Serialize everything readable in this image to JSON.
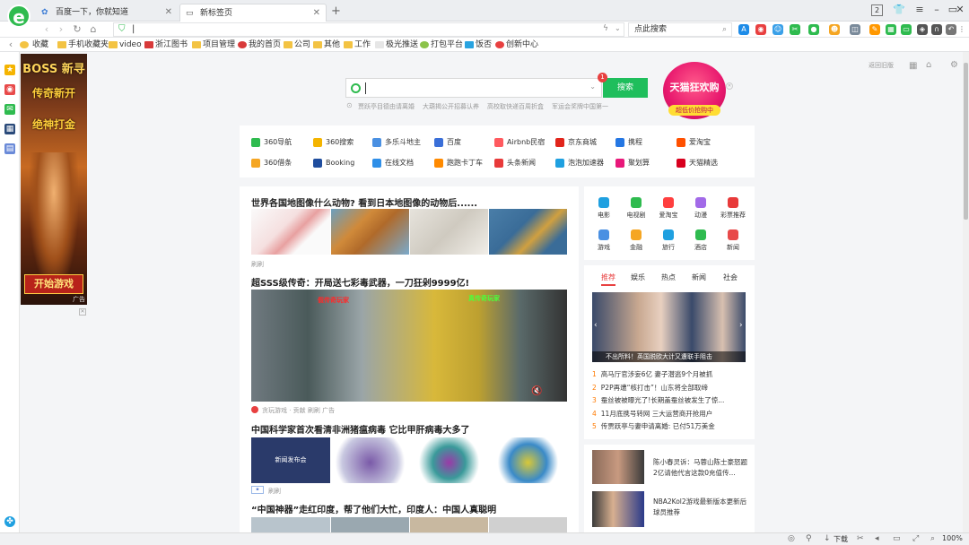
{
  "browser": {
    "logo_glyph": "e",
    "tabs": [
      {
        "title": "百度一下，你就知道",
        "icon": "baidu-icon"
      },
      {
        "title": "新标签页",
        "icon": "newtab-icon"
      }
    ],
    "new_tab_symbol": "+",
    "window_counter": "2",
    "address_value": "|",
    "search_placeholder": "点此搜索"
  },
  "bookmarks": [
    {
      "label": "收藏"
    },
    {
      "label": "手机收藏夹"
    },
    {
      "label": "video"
    },
    {
      "label": "浙江图书"
    },
    {
      "label": "项目管理"
    },
    {
      "label": "我的首页"
    },
    {
      "label": "公司"
    },
    {
      "label": "其他"
    },
    {
      "label": "工作"
    },
    {
      "label": "极光推送"
    },
    {
      "label": "打包平台"
    },
    {
      "label": "饭否"
    },
    {
      "label": "创新中心"
    }
  ],
  "ad_left": {
    "title": "BOSS 新寻",
    "line2": "传奇新开",
    "line3": "绝神打金",
    "button": "开始游戏",
    "tag": "广告"
  },
  "search": {
    "button": "搜索",
    "badge": "1",
    "hints": [
      "贾跃亭目德由请离婚",
      "大葫揭公开招募认养",
      "高校取快递百周折盒",
      "军运会奖牌中国第一"
    ]
  },
  "tmall": {
    "title": "天猫狂欢购",
    "sub": "超低价抢购中"
  },
  "top_right_link": "返回旧版",
  "quicklinks": [
    {
      "label": "360导航",
      "color": "#2fbb4f"
    },
    {
      "label": "360搜索",
      "color": "#f4b400"
    },
    {
      "label": "多乐斗地主",
      "color": "#4a90e2"
    },
    {
      "label": "百度",
      "color": "#3a6fd8"
    },
    {
      "label": "Airbnb民宿",
      "color": "#ff5a5f"
    },
    {
      "label": "京东商城",
      "color": "#e1251b"
    },
    {
      "label": "携程",
      "color": "#2577e3"
    },
    {
      "label": "爱淘宝",
      "color": "#ff5000"
    },
    {
      "label": "360借条",
      "color": "#f5a623"
    },
    {
      "label": "Booking",
      "color": "#1f4d9e"
    },
    {
      "label": "在线文档",
      "color": "#2f8fe8"
    },
    {
      "label": "跑跑卡丁车",
      "color": "#ff8a00"
    },
    {
      "label": "头条新闻",
      "color": "#e83a3a"
    },
    {
      "label": "泡泡加速器",
      "color": "#1fa0e0"
    },
    {
      "label": "聚划算",
      "color": "#e8187a"
    },
    {
      "label": "天猫精选",
      "color": "#d8001e"
    }
  ],
  "feed": [
    {
      "title": "世界各国地图像什么动物? 看到日本地图像的动物后......",
      "meta": "刷刷"
    },
    {
      "title": "超SSS级传奇：开局送七彩毒武器，一刀狂剁9999亿!",
      "meta": "贪玩游戏 · 贡献   刷刷   广告",
      "overlay_left": "假传奇玩家",
      "overlay_right": "真传奇玩家"
    },
    {
      "title": "中国科学家首次看清非洲猪瘟病毒 它比甲肝病毒大多了",
      "meta": "刷刷",
      "thumb_text": "新闻发布会"
    },
    {
      "title": "“中国神器”走红印度，帮了他们大忙，印度人：中国人真聪明"
    }
  ],
  "categories": [
    {
      "label": "电影",
      "color": "#1fa0e0"
    },
    {
      "label": "电视剧",
      "color": "#2fbb4f"
    },
    {
      "label": "爱淘宝",
      "color": "#ff3f3f"
    },
    {
      "label": "动漫",
      "color": "#a26ae8"
    },
    {
      "label": "彩票推荐",
      "color": "#e83a3a"
    },
    {
      "label": "游戏",
      "color": "#4a90e2"
    },
    {
      "label": "金融",
      "color": "#f5a623"
    },
    {
      "label": "旅行",
      "color": "#1fa0e0"
    },
    {
      "label": "酒店",
      "color": "#2fbb4f"
    },
    {
      "label": "新闻",
      "color": "#e84a4a"
    }
  ],
  "news_tabs": [
    "推荐",
    "娱乐",
    "热点",
    "新闻",
    "社会"
  ],
  "news_caption": "不出所料！英国脱欧大计又遭联手阻击",
  "news_items": [
    {
      "n": "1",
      "text": "高马厅官涉妄6亿 妻子潜逃9个月被抓"
    },
    {
      "n": "2",
      "text": "P2P再遭“核打击”！山东将全部取缔"
    },
    {
      "n": "3",
      "text": "蚕丝被被曝光了!长期盖蚕丝被发生了惊..."
    },
    {
      "n": "4",
      "text": "11月底携号转网 三大运营商开抢用户"
    },
    {
      "n": "5",
      "text": "传贾跃亭与妻申请离婚: 已付51万美金"
    }
  ],
  "side_stories": [
    {
      "title": "陈小春灵诉：马蓉山陈士豪怒题2亿请他代言这款0充值传..."
    },
    {
      "title": "NBA2Kol2游戏最新版本更新后球员推荐"
    }
  ],
  "status": {
    "download": "下载",
    "zoom": "100%"
  }
}
